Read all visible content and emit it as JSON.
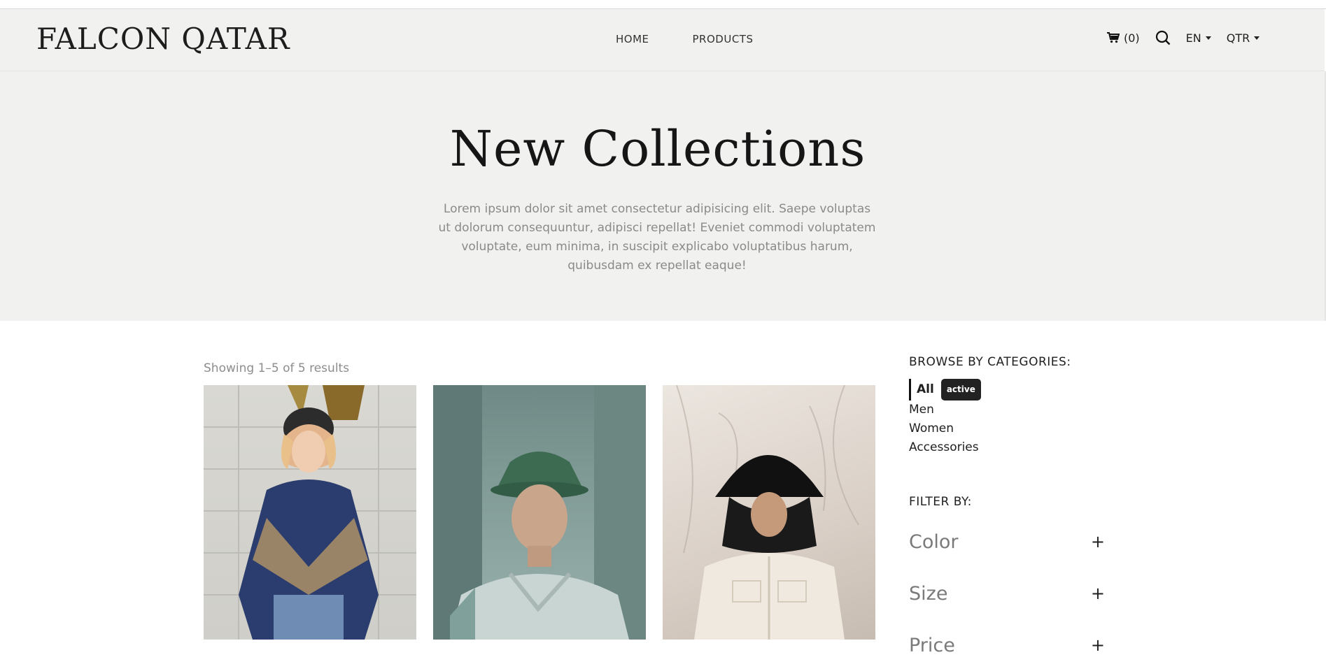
{
  "header": {
    "logo": "FALCON QATAR",
    "nav": [
      {
        "label": "HOME"
      },
      {
        "label": "PRODUCTS"
      }
    ],
    "cart_count": "(0)",
    "language": "EN",
    "currency": "QTR"
  },
  "hero": {
    "title": "New Collections",
    "description": "Lorem ipsum dolor sit amet consectetur adipisicing elit. Saepe voluptas ut dolorum consequuntur, adipisci repellat! Eveniet commodi voluptatem voluptate, eum minima, in suscipit explicabo voluptatibus harum, quibusdam ex repellat eaque!"
  },
  "results_text": "Showing 1–5 of 5 results",
  "sidebar": {
    "categories_heading": "BROWSE BY CATEGORIES:",
    "categories": [
      {
        "label": "All",
        "badge": "active"
      },
      {
        "label": "Men"
      },
      {
        "label": "Women"
      },
      {
        "label": "Accessories"
      }
    ],
    "filter_heading": "FILTER BY:",
    "filters": [
      {
        "label": "Color"
      },
      {
        "label": "Size"
      },
      {
        "label": "Price"
      }
    ]
  },
  "icons": {
    "cart": "cart-icon",
    "search": "search-icon",
    "expand": "plus-icon"
  }
}
